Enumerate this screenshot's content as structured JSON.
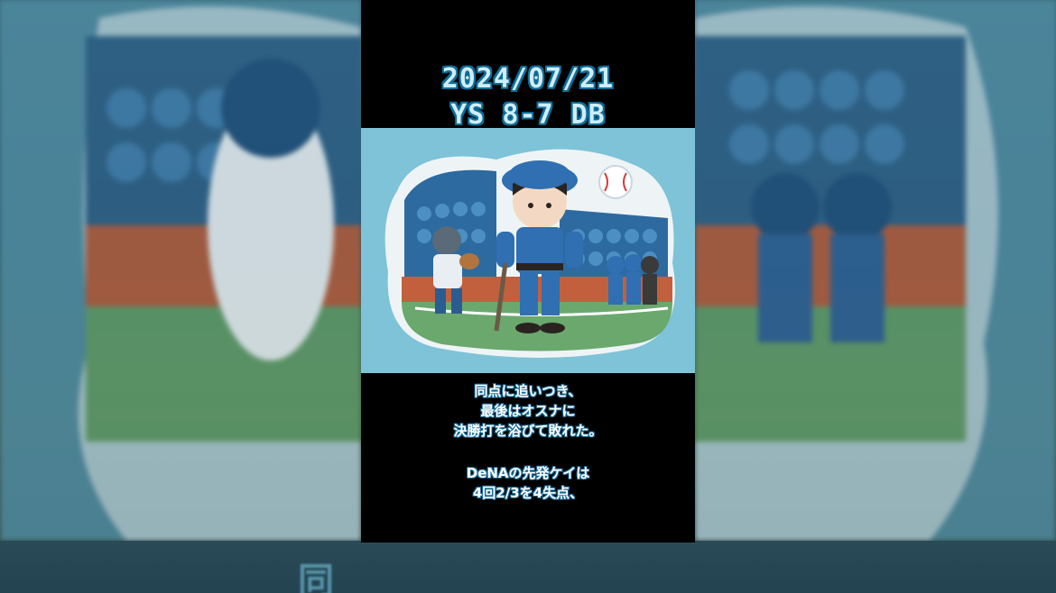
{
  "overlay": {
    "date": "2024/07/21",
    "score": "YS 8-7 DB"
  },
  "captions": {
    "line1": "同点に追いつき、",
    "line2": "最後はオスナに",
    "line3": "決勝打を浴びて敗れた。",
    "line4": "DeNAの先発ケイは",
    "line5": "4回2/3を4失点、"
  },
  "background": {
    "bottom_text": "同"
  },
  "colors": {
    "title_fill": "#cdeefc",
    "title_stroke": "#0d6e9a",
    "caption_stroke": "#1b6d9a",
    "sky": "#7ec3d8",
    "uniform": "#2f6fb2"
  }
}
